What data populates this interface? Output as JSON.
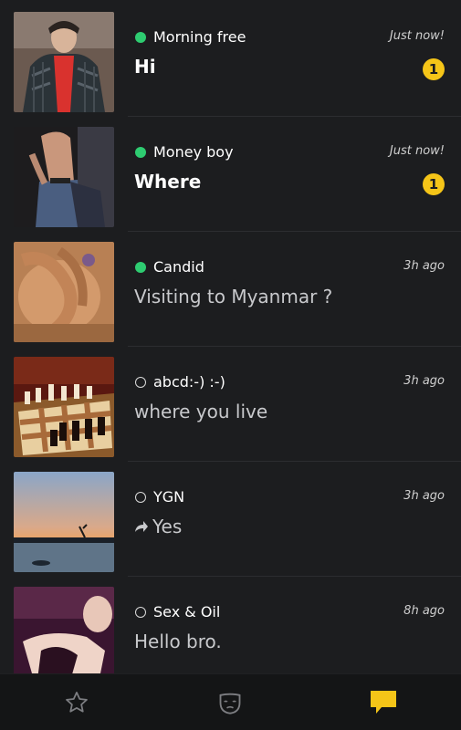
{
  "conversations": [
    {
      "name": "Morning free",
      "online": true,
      "time": "Just now!",
      "message": "Hi",
      "unread": "1",
      "replied": false
    },
    {
      "name": "Money boy",
      "online": true,
      "time": "Just now!",
      "message": "Where",
      "unread": "1",
      "replied": false
    },
    {
      "name": "Candid",
      "online": true,
      "time": "3h ago",
      "message": "Visiting to Myanmar ?",
      "unread": null,
      "replied": false
    },
    {
      "name": "abcd:-) :-)",
      "online": false,
      "time": "3h ago",
      "message": "where you live",
      "unread": null,
      "replied": false
    },
    {
      "name": "YGN",
      "online": false,
      "time": "3h ago",
      "message": "Yes",
      "unread": null,
      "replied": true
    },
    {
      "name": "Sex & Oil",
      "online": false,
      "time": "8h ago",
      "message": "Hello bro.",
      "unread": null,
      "replied": false
    }
  ],
  "colors": {
    "background": "#1c1d1f",
    "online": "#2ecc71",
    "badge": "#f5c518",
    "active_tab": "#f5c518"
  },
  "tabs": [
    {
      "icon": "star-icon",
      "active": false
    },
    {
      "icon": "mask-icon",
      "active": false
    },
    {
      "icon": "chat-bubble-icon",
      "active": true
    }
  ]
}
